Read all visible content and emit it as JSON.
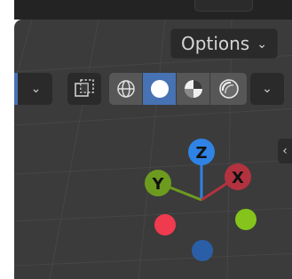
{
  "header": {
    "options_label": "Options",
    "options_chevron": "⌄"
  },
  "toolbar": {
    "left_dropdown_chevron": "⌄",
    "xray_icon": "xray-toggle-icon",
    "shading_modes": [
      {
        "name": "wireframe",
        "icon": "wireframe-shading-icon",
        "active": false
      },
      {
        "name": "solid",
        "icon": "solid-shading-icon",
        "active": true
      },
      {
        "name": "material-preview",
        "icon": "material-preview-icon",
        "active": false
      },
      {
        "name": "rendered",
        "icon": "rendered-shading-icon",
        "active": false
      }
    ],
    "shading_dropdown_chevron": "⌄"
  },
  "sidebar_toggle": {
    "chevron": "‹"
  },
  "navigation_gizmo": {
    "z_label": "Z",
    "y_label": "Y",
    "x_label": "X",
    "colors": {
      "z": "#2f83e4",
      "y": "#6d9b1f",
      "x": "#b3323f",
      "neg_x": "#f03a4e",
      "neg_y": "#85c51b",
      "neg_z": "#2a5fa7"
    }
  },
  "colors": {
    "viewport_bg": "#3b3b3b",
    "grid_line": "#464646",
    "header_bg": "#232323",
    "button_bg": "#2a2a2a",
    "active_blue": "#4772b3",
    "shading_group_bg": "#575757"
  }
}
